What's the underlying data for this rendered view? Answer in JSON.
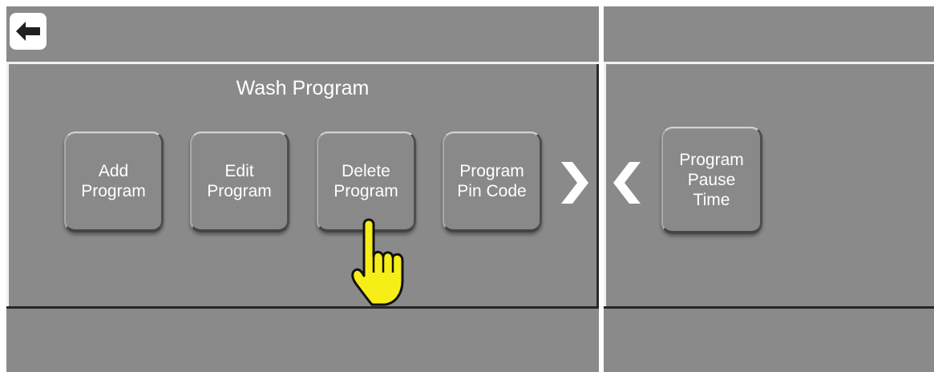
{
  "left_screen": {
    "panel_title": "Wash Program",
    "buttons": [
      {
        "label": "Add\nProgram"
      },
      {
        "label": "Edit\nProgram"
      },
      {
        "label": "Delete\nProgram"
      },
      {
        "label": "Program\nPin Code"
      }
    ],
    "next_icon": "chevron-right-icon",
    "back_icon": "arrow-left-icon",
    "pointer_icon": "hand-pointer-icon"
  },
  "right_screen": {
    "prev_icon": "chevron-left-icon",
    "buttons": [
      {
        "label": "Program\nPause\nTime"
      }
    ]
  },
  "colors": {
    "background": "#8a8a8a",
    "text": "#ffffff",
    "highlight": "#f7ee17"
  }
}
